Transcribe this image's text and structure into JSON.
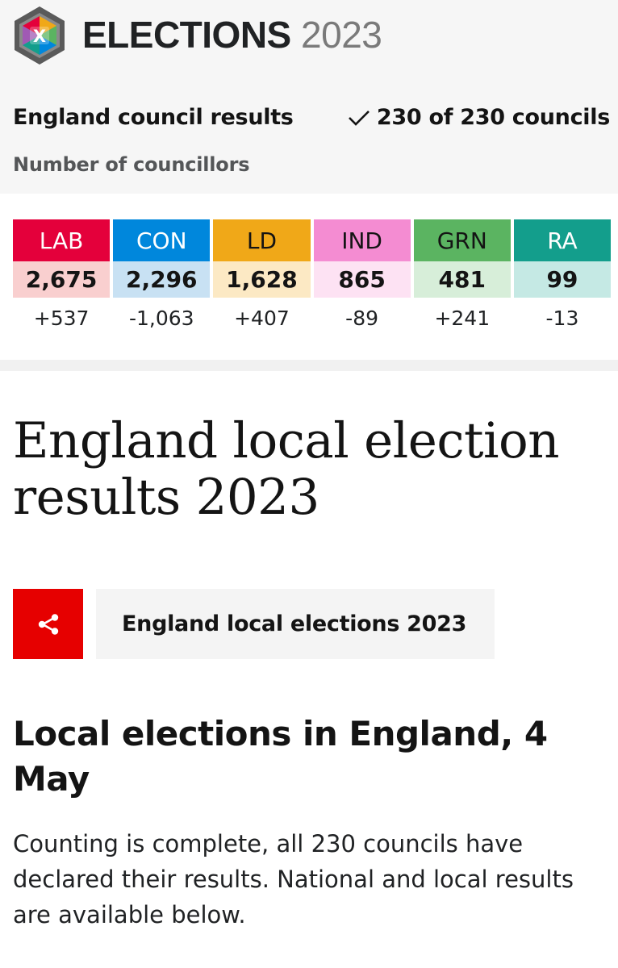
{
  "header": {
    "brand_word": "ELECTIONS",
    "brand_year": "2023",
    "logo_letter": "X"
  },
  "summary": {
    "title": "England council results",
    "declared_label": "230 of 230 councils",
    "metric_label": "Number of councillors"
  },
  "parties": [
    {
      "code": "LAB",
      "seats": "2,675",
      "change": "+537",
      "color": "#e4003b",
      "tint": "#f9cfcf"
    },
    {
      "code": "CON",
      "seats": "2,296",
      "change": "-1,063",
      "color": "#0087dc",
      "tint": "#c8e1f3"
    },
    {
      "code": "LD",
      "seats": "1,628",
      "change": "+407",
      "color": "#f0a818",
      "tint": "#fce9c4"
    },
    {
      "code": "IND",
      "seats": "865",
      "change": "-89",
      "color": "#f48cd2",
      "tint": "#fde2f3"
    },
    {
      "code": "GRN",
      "seats": "481",
      "change": "+241",
      "color": "#5bb461",
      "tint": "#d7eed9"
    },
    {
      "code": "RA",
      "seats": "99",
      "change": "-13",
      "color": "#139e8c",
      "tint": "#c5e9e4"
    }
  ],
  "headline": "England local election results 2023",
  "share_icon": "share-icon",
  "topic_link": "England local elections 2023",
  "section": {
    "title": "Local elections in England, 4 May",
    "body": "Counting is complete, all 230 councils have declared their results. National and local results are available below."
  },
  "colors": {
    "accent_red": "#e60000",
    "banner_bg": "#f6f6f6"
  }
}
